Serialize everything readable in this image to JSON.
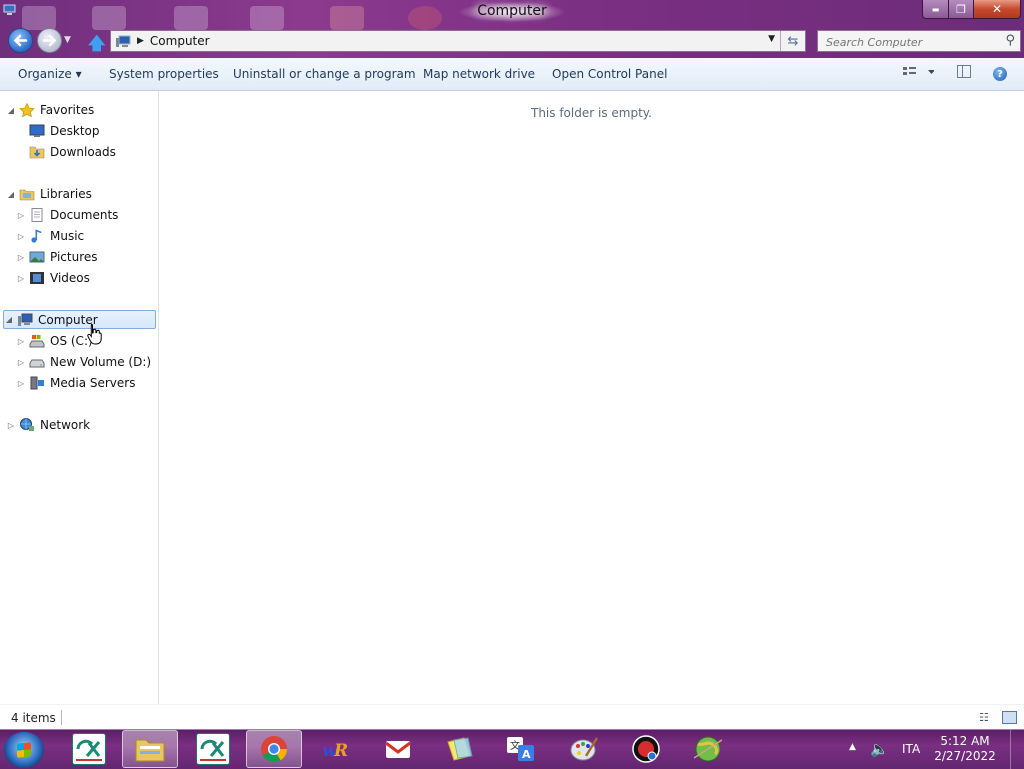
{
  "window": {
    "title": "Computer",
    "caption_buttons": {
      "minimize": "▬",
      "maximize": "❐",
      "close": "✕"
    }
  },
  "nav": {
    "address_path": "Computer",
    "search_placeholder": "Search Computer"
  },
  "toolbar": {
    "organize": "Organize ▾",
    "system_properties": "System properties",
    "uninstall": "Uninstall or change a program",
    "map_drive": "Map network drive",
    "control_panel": "Open Control Panel",
    "help": "?"
  },
  "tree": {
    "favorites": "Favorites",
    "desktop": "Desktop",
    "downloads": "Downloads",
    "libraries": "Libraries",
    "documents": "Documents",
    "music": "Music",
    "pictures": "Pictures",
    "videos": "Videos",
    "computer": "Computer",
    "os_c": "OS (C:)",
    "new_volume_d": "New Volume (D:)",
    "media_servers": "Media Servers",
    "network": "Network"
  },
  "content": {
    "empty_message": "This folder is empty."
  },
  "status": {
    "item_count": "4 items"
  },
  "taskbar": {
    "language": "ITA",
    "time": "5:12 AM",
    "date": "2/27/2022",
    "apps": [
      "credit-agricole-icon",
      "file-explorer-icon",
      "credit-agricole-icon",
      "chrome-icon",
      "wr-icon",
      "gmail-icon",
      "sticky-notes-icon",
      "translate-icon",
      "paint-icon",
      "media-player-icon",
      "earth-icon"
    ]
  },
  "colors": {
    "frame": "#7a2f82",
    "selection": "#d7e8fb",
    "link": "#1e395b"
  }
}
